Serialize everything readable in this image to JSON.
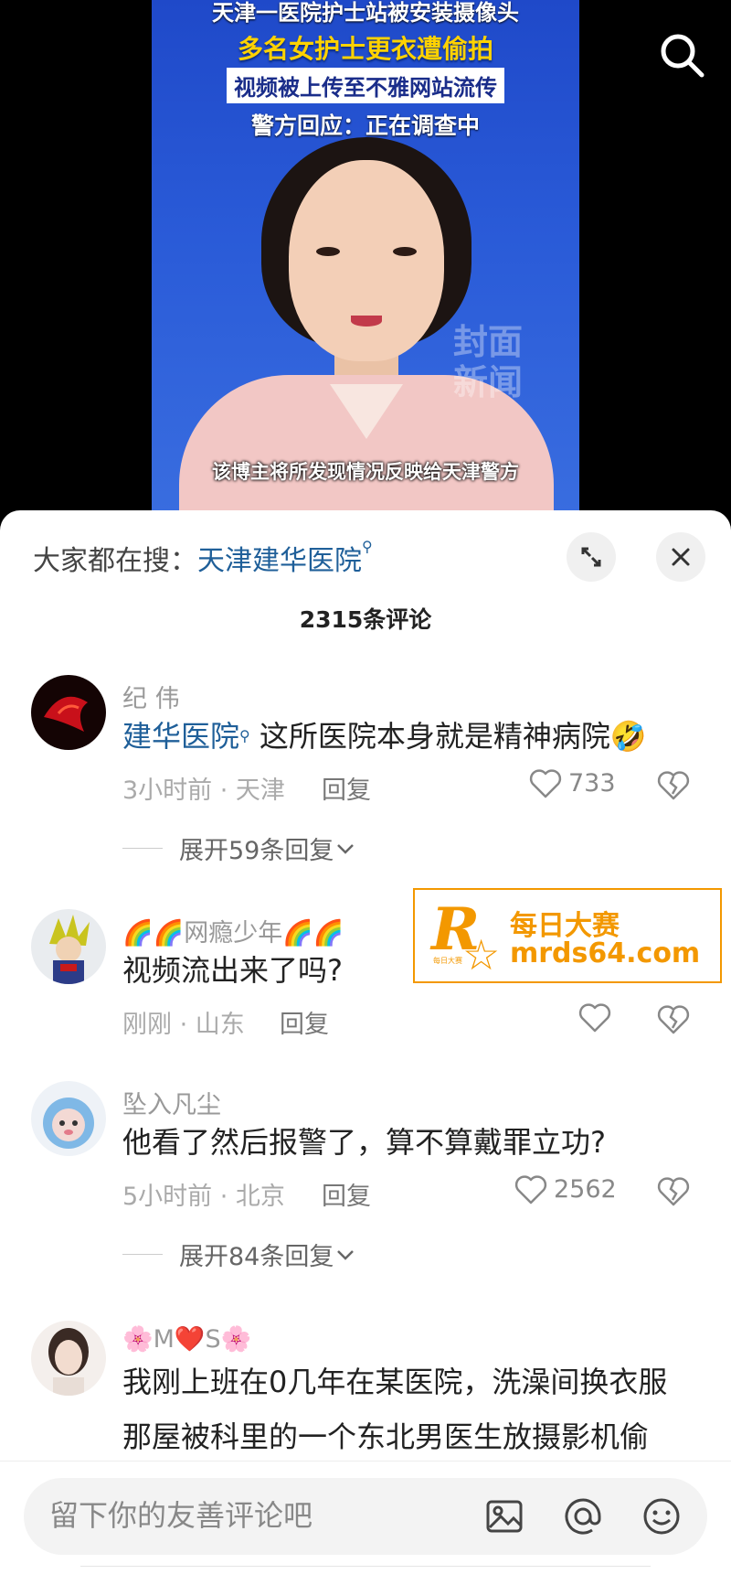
{
  "video": {
    "headline_lines": [
      "天津一医院护士站被安装摄像头",
      "多名女护士更衣遭偷拍",
      "视频被上传至不雅网站流传",
      "警方回应：正在调查中"
    ],
    "watermark": [
      "封面",
      "新闻"
    ],
    "subtitle": "该博主将所发现情况反映给天津警方",
    "search_icon": "search-icon"
  },
  "sheet": {
    "hot_search_prefix": "大家都在搜：",
    "hot_search_term": "天津建华医院",
    "expand_icon": "expand-icon",
    "close_icon": "close-icon",
    "comment_count": "2315条评论"
  },
  "comments": [
    {
      "user": "纪 伟",
      "tag": "建华医院",
      "text": " 这所医院本身就是精神病院🤣",
      "time_location": "3小时前 · 天津",
      "reply_label": "回复",
      "likes": "733",
      "expand_label": "展开59条回复"
    },
    {
      "user": "🌈🌈网瘾少年🌈🌈",
      "text": "视频流出来了吗?",
      "time_location": "刚刚 · 山东",
      "reply_label": "回复",
      "likes": ""
    },
    {
      "user": "坠入凡尘",
      "text": "他看了然后报警了，算不算戴罪立功?",
      "time_location": "5小时前 · 北京",
      "reply_label": "回复",
      "likes": "2562",
      "expand_label": "展开84条回复"
    },
    {
      "user": "🌸M❤️S🌸",
      "text_lines": [
        "我刚上班在0几年在某医院，洗澡间换衣服",
        "那屋被科里的一个东北男医生放摄影机偷"
      ]
    }
  ],
  "ad": {
    "logo_letter": "R",
    "logo_small": "每日大赛",
    "name": "每日大赛",
    "url": "mrds64.com",
    "color": "#f39800"
  },
  "input": {
    "placeholder": "留下你的友善评论吧",
    "icons": [
      "image-icon",
      "at-icon",
      "emoji-icon"
    ]
  },
  "colors": {
    "link_blue": "#1f5f99",
    "muted": "#999999",
    "video_bg": "#2a5bd8"
  }
}
